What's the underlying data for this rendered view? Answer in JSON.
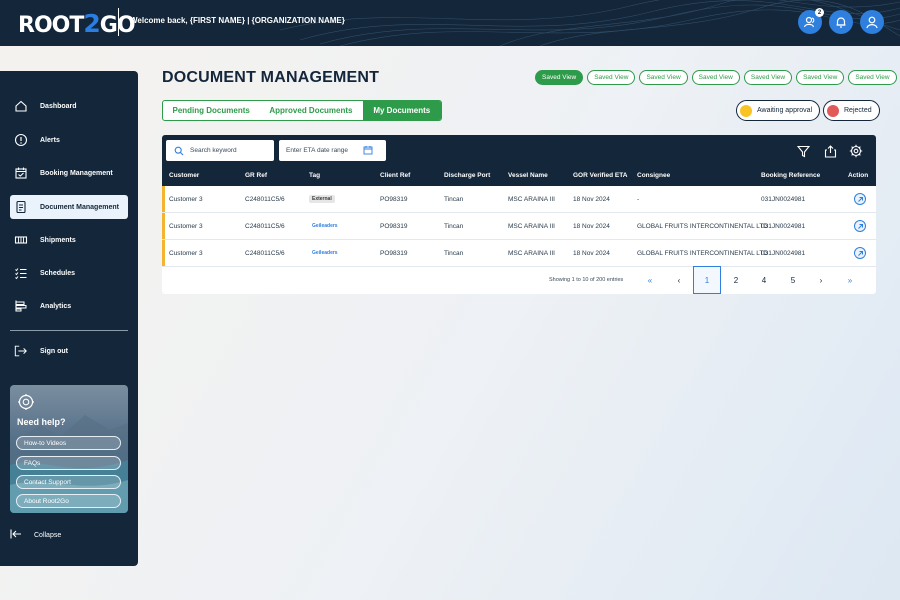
{
  "header": {
    "logo_left": "ROOT",
    "logo_mid": "2",
    "logo_right": "GO",
    "welcome": "Welcome back, {FIRST NAME} | {ORGANIZATION NAME}",
    "notification_count": "2",
    "icons": [
      "user-group-icon",
      "bell-icon",
      "user-icon"
    ]
  },
  "sidebar": {
    "items": [
      {
        "label": "Dashboard",
        "icon": "home-icon"
      },
      {
        "label": "Alerts",
        "icon": "alert-icon"
      },
      {
        "label": "Booking Management",
        "icon": "calendar-check-icon"
      },
      {
        "label": "Document Management",
        "icon": "document-icon"
      },
      {
        "label": "Shipments",
        "icon": "container-icon"
      },
      {
        "label": "Schedules",
        "icon": "list-check-icon"
      },
      {
        "label": "Analytics",
        "icon": "bar-chart-icon"
      }
    ],
    "active_index": 3,
    "sign_out": "Sign out",
    "help": {
      "title": "Need help?",
      "links": [
        "How-to Videos",
        "FAQs",
        "Contact Support",
        "About Root2Go"
      ]
    },
    "collapse": "Collapse"
  },
  "main": {
    "title": "DOCUMENT MANAGEMENT",
    "saved_views": [
      "Saved View",
      "Saved View",
      "Saved View",
      "Saved View",
      "Saved View",
      "Saved View",
      "Saved View"
    ],
    "tabs": [
      "Pending Documents",
      "Approved Documents",
      "My Documents"
    ],
    "active_tab": 2,
    "status_filters": [
      {
        "label": "Awaiting approval",
        "color": "#f7c325"
      },
      {
        "label": "Rejected",
        "color": "#e05a5a"
      }
    ],
    "search_placeholder": "Search keyword",
    "date_placeholder": "Enter ETA date range",
    "columns": [
      "Customer",
      "GR Ref",
      "Tag",
      "Client Ref",
      "Discharge Port",
      "Vessel Name",
      "GOR Verified ETA",
      "Consignee",
      "Booking Reference",
      "Action"
    ],
    "rows": [
      {
        "customer": "Customer 3",
        "gr_ref": "C248011C5/6",
        "tag": "External",
        "tag_type": "external",
        "client_ref": "PO98319",
        "port": "Tincan",
        "vessel": "MSC ARAINA III",
        "eta": "18 Nov 2024",
        "consignee": "-",
        "booking": "031JN0024981"
      },
      {
        "customer": "Customer 3",
        "gr_ref": "C248011C5/6",
        "tag": "Geileaders",
        "tag_type": "geo",
        "client_ref": "PO98319",
        "port": "Tincan",
        "vessel": "MSC ARAINA III",
        "eta": "18 Nov 2024",
        "consignee": "GLOBAL FRUITS INTERCONTINENTAL LTD",
        "booking": "031JN0024981"
      },
      {
        "customer": "Customer 3",
        "gr_ref": "C248011C5/6",
        "tag": "Geileaders",
        "tag_type": "geo",
        "client_ref": "PO98319",
        "port": "Tincan",
        "vessel": "MSC ARAINA III",
        "eta": "18 Nov 2024",
        "consignee": "GLOBAL FRUITS INTERCONTINENTAL LTD",
        "booking": "031JN0024981"
      }
    ],
    "pagination": {
      "summary": "Showing 1 to 10 of 200 entries",
      "first": "«",
      "prev": "‹",
      "pages": [
        "1",
        "2",
        "4",
        "5"
      ],
      "current": "1",
      "next": "›",
      "last": "»"
    }
  },
  "colors": {
    "navy": "#13263a",
    "green": "#2e9b4a",
    "blue": "#2f7fde",
    "row_accent": "#f2b431"
  }
}
